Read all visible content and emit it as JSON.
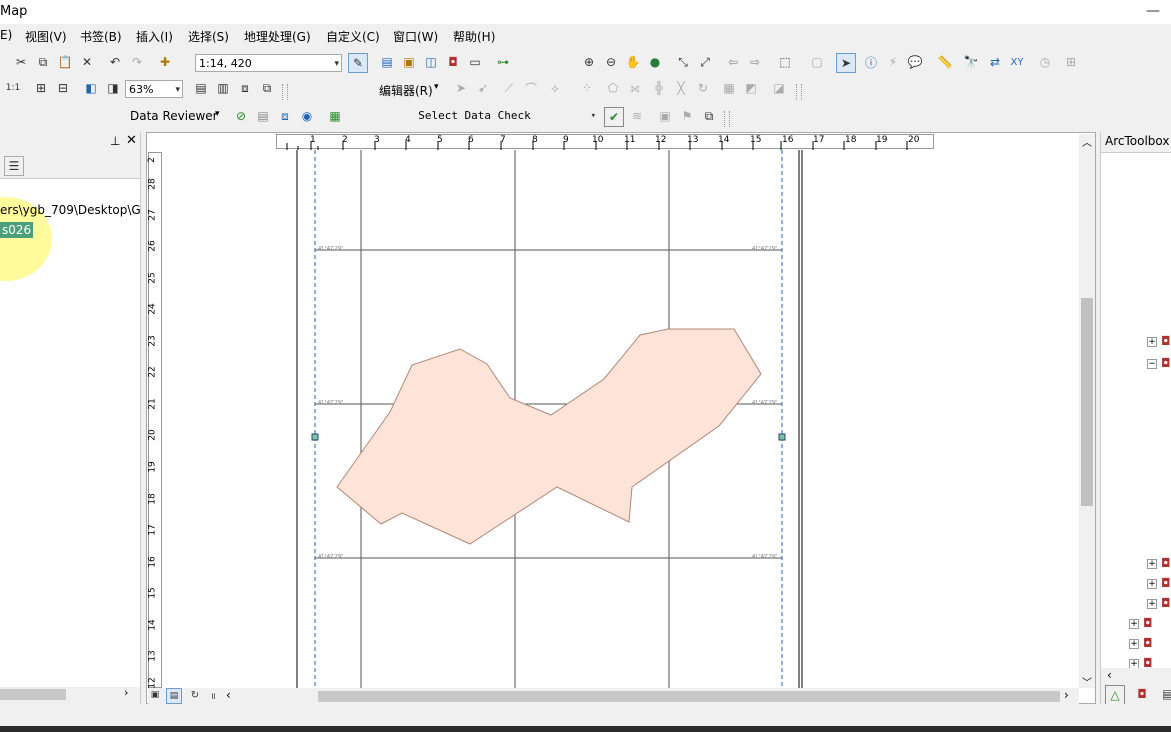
{
  "window": {
    "title": "Map"
  },
  "menubar": {
    "items": [
      "E)",
      "视图(V)",
      "书签(B)",
      "插入(I)",
      "选择(S)",
      "地理处理(G)",
      "自定义(C)",
      "窗口(W)",
      "帮助(H)"
    ]
  },
  "toolbar": {
    "scale_value": "1:14, 420",
    "zoom_value": "63%",
    "editor_label": "编辑器(R)",
    "data_reviewer_label": "Data Reviewer",
    "select_check_label": "Select Data Check"
  },
  "toc": {
    "path_text": "ers\\ygb_709\\Desktop\\G",
    "layer_text": "s026"
  },
  "arctoolbox": {
    "title": "ArcToolbox"
  },
  "ruler": {
    "top_labels": [
      "1",
      "2",
      "3",
      "4",
      "5",
      "6",
      "7",
      "8",
      "9",
      "10",
      "11",
      "12",
      "13",
      "14",
      "15",
      "16",
      "17",
      "18",
      "19",
      "20"
    ],
    "left_labels": [
      "2",
      "28",
      "27",
      "26",
      "25",
      "24",
      "23",
      "22",
      "21",
      "20",
      "19",
      "18",
      "17",
      "16",
      "15",
      "14",
      "13",
      "12"
    ]
  },
  "grid_labels": {
    "left": "41°47'29\"",
    "right": "41°47'29\""
  },
  "colors": {
    "polygon_fill": "#fde3d8",
    "polygon_stroke": "#b08878",
    "highlight": "#7fc3a0",
    "accent": "#1e66b4"
  }
}
